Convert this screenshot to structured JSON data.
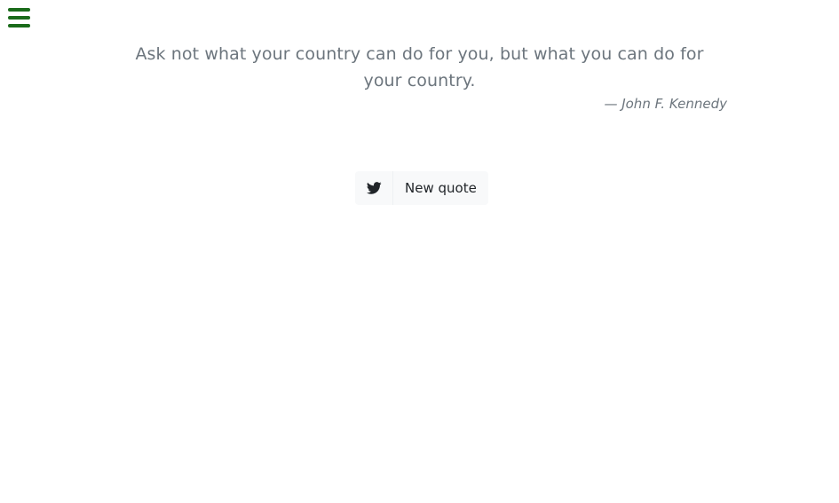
{
  "menu": {
    "icon": "hamburger-menu-icon",
    "color": "#1a6b1a"
  },
  "quote": {
    "text": "Ask not what your country can do for you, but what you can do for your country.",
    "author": "— John F. Kennedy",
    "text_color": "#6c757d"
  },
  "actions": {
    "tweet_icon": "twitter-icon",
    "new_quote_label": "New quote",
    "button_background": "#f8f9fa"
  }
}
